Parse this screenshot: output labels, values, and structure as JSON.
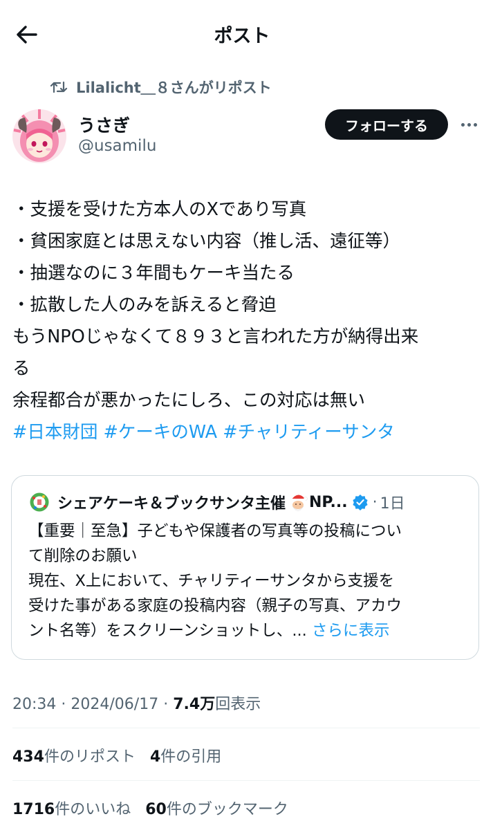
{
  "header": {
    "title": "ポスト"
  },
  "repost": {
    "text": "Lilalicht＿８さんがリポスト"
  },
  "author": {
    "display_name": "うさぎ",
    "handle": "@usamilu",
    "follow_label": "フォローする"
  },
  "post": {
    "lines": [
      "・支援を受けた方本人のXであり写真",
      "・貧困家庭とは思えない内容（推し活、遠征等）",
      "・抽選なのに３年間もケーキ当たる",
      "・拡散した人のみを訴えると脅迫",
      "もうNPOじゃなくて８９３と言われた方が納得出来",
      "る",
      "余程都合が悪かったにしろ、この対応は無い"
    ],
    "hashtags": "#日本財団 #ケーキのWA #チャリティーサンタ"
  },
  "quote": {
    "name": "シェアケーキ＆ブックサンタ主催",
    "name_suffix": "NP...",
    "separator": "·",
    "time": "1日",
    "lines": [
      "【重要｜至急】子どもや保護者の写真等の投稿につい",
      "て削除のお願い",
      "現在、X上において、チャリティーサンタから支援を",
      "受けた事がある家庭の投稿内容（親子の写真、アカウ",
      "ント名等）をスクリーンショットし、..."
    ],
    "show_more": "さらに表示"
  },
  "meta": {
    "time": "20:34",
    "date": "2024/06/17",
    "separator": "·",
    "views": "7.4万",
    "views_label": "回表示"
  },
  "stats": {
    "reposts": "434",
    "reposts_label": "件のリポスト",
    "quotes": "4",
    "quotes_label": "件の引用",
    "likes": "1716",
    "likes_label": "件のいいね",
    "bookmarks": "60",
    "bookmarks_label": "件のブックマーク"
  },
  "colors": {
    "accent": "#1d9bf0",
    "text": "#0f1419",
    "muted": "#536471",
    "border": "#cfd9de"
  }
}
